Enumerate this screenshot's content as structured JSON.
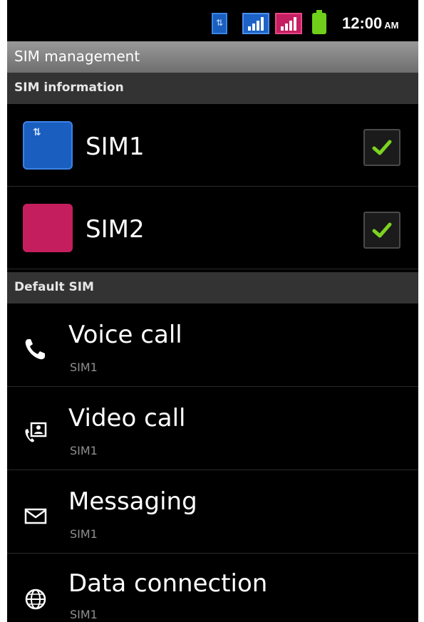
{
  "status_bar": {
    "time": "12:00",
    "ampm": "AM"
  },
  "title_bar": {
    "title": "SIM management"
  },
  "sections": {
    "sim_information": "SIM information",
    "default_sim": "Default SIM"
  },
  "sims": [
    {
      "label": "SIM1",
      "color": "#1a5fbf",
      "checked": true
    },
    {
      "label": "SIM2",
      "color": "#c41e5e",
      "checked": true
    }
  ],
  "settings": [
    {
      "title": "Voice call",
      "value": "SIM1",
      "icon": "phone-icon"
    },
    {
      "title": "Video call",
      "value": "SIM1",
      "icon": "video-call-icon"
    },
    {
      "title": "Messaging",
      "value": "SIM1",
      "icon": "envelope-icon"
    },
    {
      "title": "Data connection",
      "value": "SIM1",
      "icon": "globe-icon"
    }
  ]
}
